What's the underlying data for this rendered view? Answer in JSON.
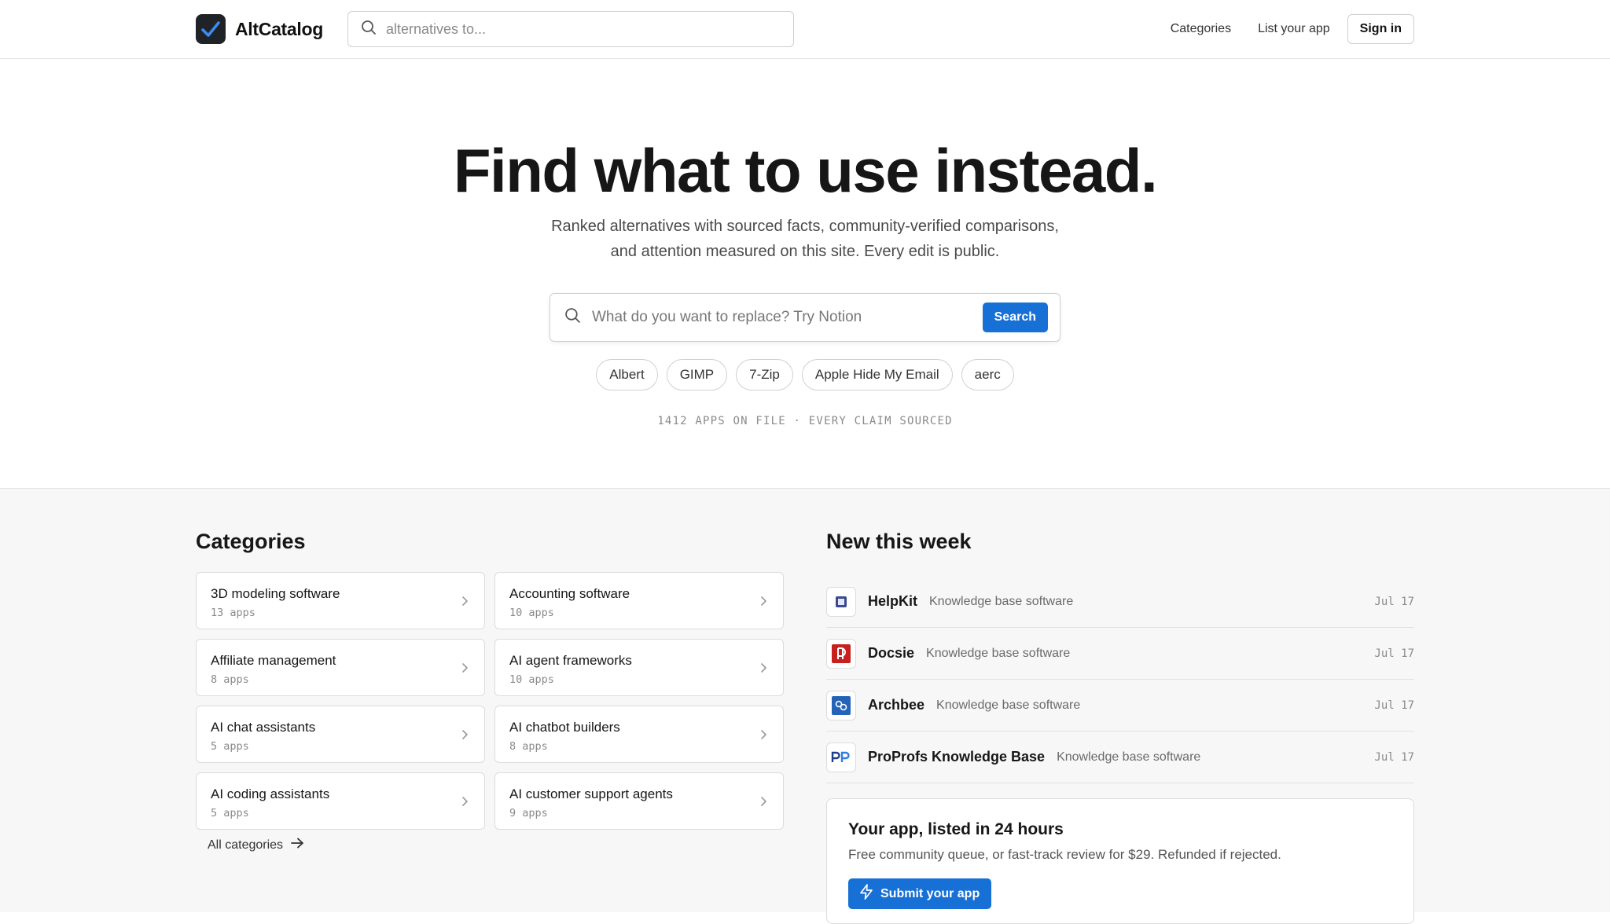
{
  "header": {
    "brand": "AltCatalog",
    "search_placeholder": "alternatives to...",
    "nav": {
      "categories": "Categories",
      "list_app": "List your app",
      "sign_in": "Sign in"
    }
  },
  "hero": {
    "title": "Find what to use instead.",
    "subtitle_line1": "Ranked alternatives with sourced facts, community-verified comparisons,",
    "subtitle_line2": "and attention measured on this site. Every edit is public.",
    "search_placeholder": "What do you want to replace? Try Notion",
    "search_button": "Search",
    "chips": [
      "Albert",
      "GIMP",
      "7-Zip",
      "Apple Hide My Email",
      "aerc"
    ],
    "stats": "1412 APPS ON FILE · EVERY CLAIM SOURCED"
  },
  "categories": {
    "title": "Categories",
    "items": [
      {
        "name": "3D modeling software",
        "count": "13 apps"
      },
      {
        "name": "Accounting software",
        "count": "10 apps"
      },
      {
        "name": "Affiliate management",
        "count": "8 apps"
      },
      {
        "name": "AI agent frameworks",
        "count": "10 apps"
      },
      {
        "name": "AI chat assistants",
        "count": "5 apps"
      },
      {
        "name": "AI chatbot builders",
        "count": "8 apps"
      },
      {
        "name": "AI coding assistants",
        "count": "5 apps"
      },
      {
        "name": "AI customer support agents",
        "count": "9 apps"
      }
    ],
    "all_link": "All categories"
  },
  "new_this_week": {
    "title": "New this week",
    "items": [
      {
        "name": "HelpKit",
        "category": "Knowledge base software",
        "date": "Jul 17",
        "icon": "helpkit-icon"
      },
      {
        "name": "Docsie",
        "category": "Knowledge base software",
        "date": "Jul 17",
        "icon": "docsie-icon"
      },
      {
        "name": "Archbee",
        "category": "Knowledge base software",
        "date": "Jul 17",
        "icon": "archbee-icon"
      },
      {
        "name": "ProProfs Knowledge Base",
        "category": "Knowledge base software",
        "date": "Jul 17",
        "icon": "proprofs-icon"
      }
    ]
  },
  "cta": {
    "title": "Your app, listed in 24 hours",
    "text": "Free community queue, or fast-track review for $29. Refunded if rejected.",
    "button": "Submit your app"
  },
  "colors": {
    "accent": "#1670d6",
    "brand_logo": "#1f2227",
    "docsie_red": "#c8201e",
    "archbee_blue": "#2563b8"
  }
}
